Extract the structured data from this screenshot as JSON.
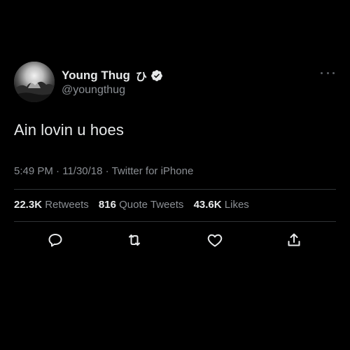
{
  "author": {
    "display_name": "Young Thug",
    "name_glyph": "ひ",
    "handle": "@youngthug",
    "avatar_icon": "avatar-photo",
    "verified_icon": "verified-badge-icon"
  },
  "tweet": {
    "text": "Ain lovin u hoes",
    "time": "5:49 PM",
    "date": "11/30/18",
    "source": "Twitter for iPhone",
    "separator": "·"
  },
  "stats": {
    "retweets_count": "22.3K",
    "retweets_label": "Retweets",
    "quotes_count": "816",
    "quotes_label": "Quote Tweets",
    "likes_count": "43.6K",
    "likes_label": "Likes"
  },
  "actions": {
    "reply_icon": "reply-icon",
    "retweet_icon": "retweet-icon",
    "like_icon": "heart-icon",
    "share_icon": "share-icon"
  },
  "colors": {
    "background": "#000000",
    "text": "#e7e9ea",
    "secondary_text": "#8b8f94",
    "divider": "#2f3336"
  }
}
